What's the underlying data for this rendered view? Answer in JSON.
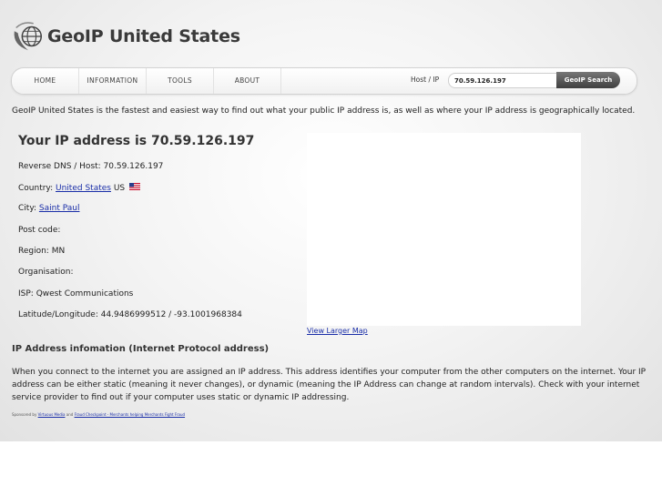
{
  "site": {
    "logo_text": "GeoIP United States",
    "logo_icon": "globe-icon"
  },
  "nav": {
    "home": "HOME",
    "information": "INFORMATION",
    "tools": "TOOLS",
    "about": "ABOUT"
  },
  "search": {
    "label": "Host / IP",
    "value": "70.59.126.197",
    "button": "GeoIP Search"
  },
  "intro": "GeoIP United States is the fastest and easiest way to find out what your public IP address is, as well as where your IP address is geographically located.",
  "ip_info": {
    "heading": "Your IP address is 70.59.126.197",
    "reverse_dns": "Reverse DNS / Host: 70.59.126.197",
    "country_label": "Country:",
    "country_link": "United States",
    "country_code": "US",
    "country_flag": "us-flag-icon",
    "city_label": "City:",
    "city_link": "Saint Paul",
    "post_code": "Post code:",
    "region": "Region: MN",
    "organisation": "Organisation:",
    "isp": "ISP: Qwest Communications",
    "lat_long": "Latitude/Longitude: 44.9486999512 / -93.1001968384"
  },
  "map": {
    "view_larger": "View Larger Map"
  },
  "section": {
    "title": "IP Address infomation (Internet Protocol address)",
    "body": "When you connect to the internet you are assigned an IP address. This address identifies your computer from the other computers on the internet. Your IP address can be either static (meaning it never changes), or dynamic (meaning the IP Address can change at random intervals). Check with your internet service provider to find out if your computer uses static or dynamic IP addressing."
  },
  "sponsor": {
    "prefix": "Sponsored by",
    "link1": "Virtuous Media",
    "and": "and",
    "link2": "Fraud Checkpoint - Merchants helping Merchants Fight Fraud"
  },
  "colors": {
    "link": "#1a2ea8",
    "button_bg": "#4a4a4a",
    "logo_text": "#3a3a3a"
  }
}
